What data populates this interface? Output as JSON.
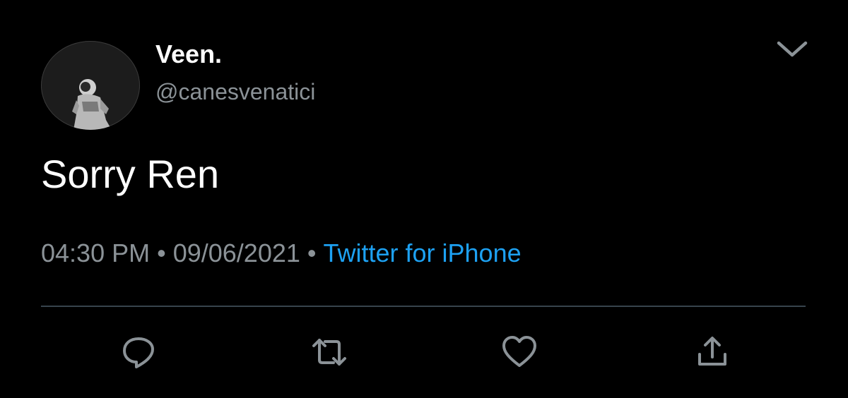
{
  "tweet": {
    "author": {
      "display_name": "Veen.",
      "handle": "@canesvenatici",
      "avatar_icon": "astronaut-avatar"
    },
    "text": "Sorry Ren",
    "meta": {
      "time": "04:30 PM",
      "separator": "•",
      "date": "09/06/2021",
      "source": "Twitter for iPhone"
    },
    "actions": [
      {
        "icon": "reply-icon"
      },
      {
        "icon": "retweet-icon"
      },
      {
        "icon": "like-icon"
      },
      {
        "icon": "share-icon"
      }
    ],
    "menu_icon": "chevron-down-icon"
  },
  "colors": {
    "background": "#000000",
    "primary_text": "#ffffff",
    "secondary_text": "#8b9297",
    "link": "#1da1f2",
    "divider": "#38444d",
    "icon": "#8b9297"
  }
}
